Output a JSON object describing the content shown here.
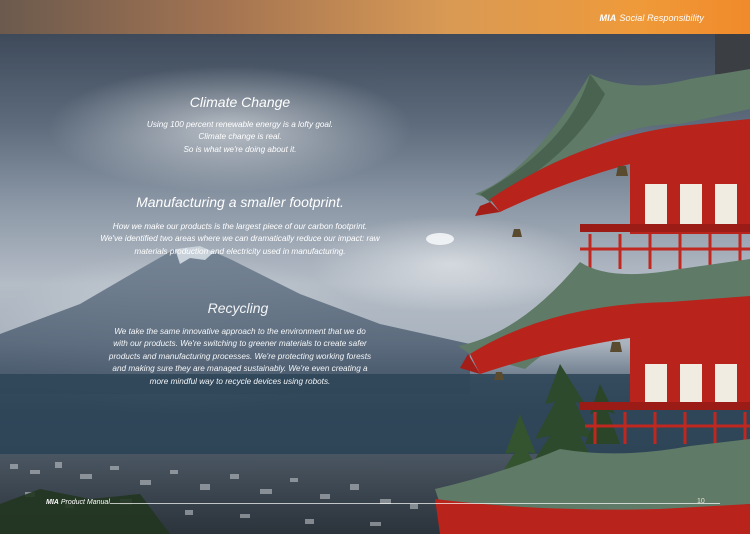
{
  "header": {
    "brand": "MIA",
    "section": "Social Responsibility"
  },
  "sections": [
    {
      "heading": "Climate Change",
      "lines": [
        "Using 100 percent renewable energy is a lofty goal.",
        "Climate change is real.",
        "So is what we're doing about it."
      ]
    },
    {
      "heading": "Manufacturing a smaller footprint.",
      "lines": [
        "How we make our products is the largest piece of our carbon footprint.",
        "We've identified two areas where we can dramatically reduce our impact: raw",
        "materials production and electricity used in manufacturing."
      ]
    },
    {
      "heading": "Recycling",
      "lines": [
        "We take the same innovative approach to the environment that we do",
        "with our products. We're switching to greener materials to create safer",
        "products and manufacturing processes. We're protecting working forests",
        "and making sure they are managed sustainably. We're even creating a",
        "more mindful way to recycle devices using robots."
      ]
    }
  ],
  "footer": {
    "brand": "MIA",
    "label": "Product Manual",
    "page_number": "10"
  },
  "colors": {
    "header_orange": "#ef9a3a",
    "pagoda_red": "#b8231c",
    "roof_green": "#5f7a66"
  }
}
